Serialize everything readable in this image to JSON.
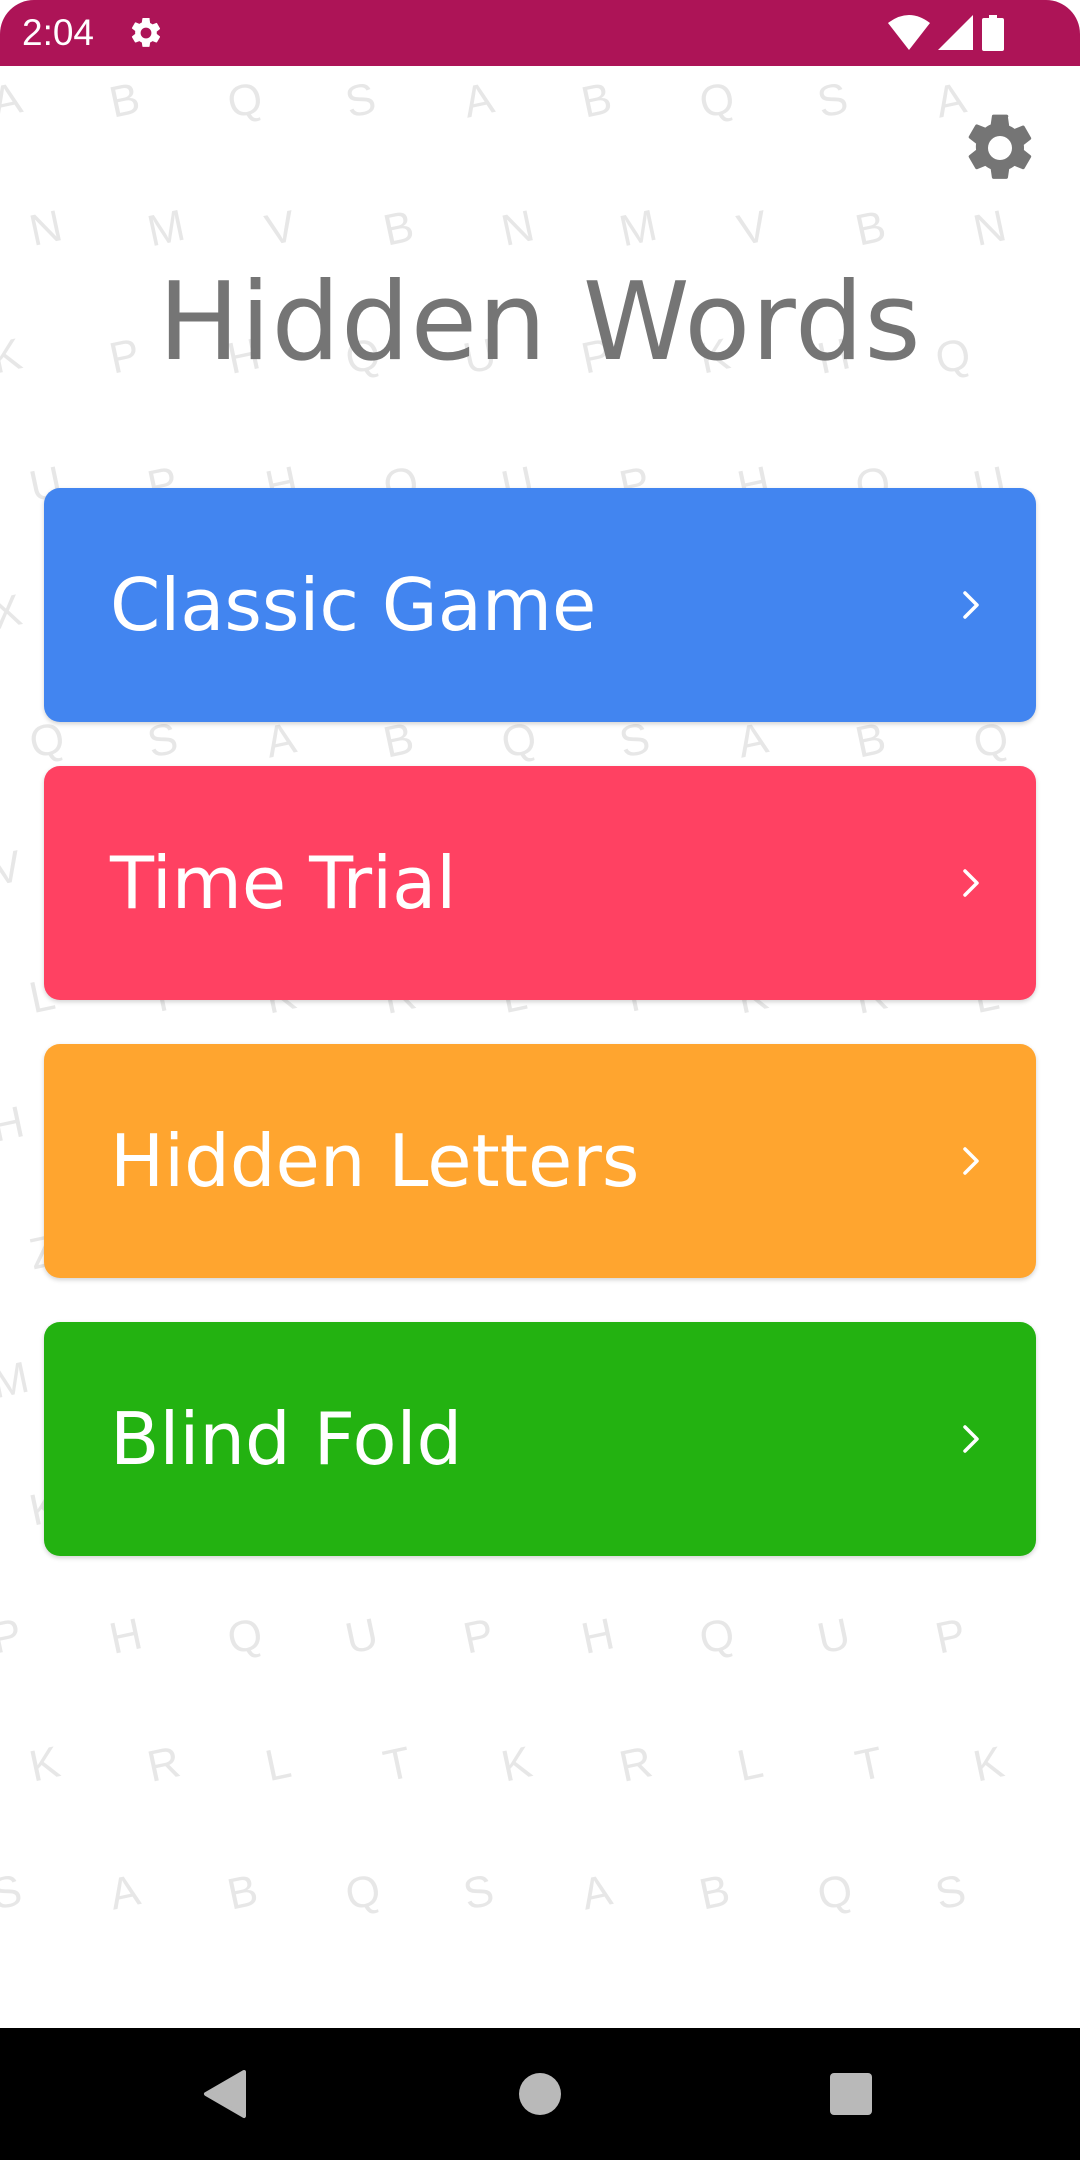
{
  "status_bar": {
    "time": "2:04",
    "background_color": "#AD1457",
    "icons": [
      "settings-gear-icon",
      "wifi-icon",
      "signal-icon",
      "battery-icon"
    ]
  },
  "background": {
    "letter_color": "#E7E7E7",
    "rows": [
      "A B Q S A B Q S A B",
      "N M V B N M V B N",
      "K P H Q U P K H Q U K",
      "U P H Q U P H Q U P",
      "X Z K P X Z K P X",
      "Q S A B Q S A B Q S",
      "V B N M V B N M V B",
      "L T K R L T K R L T",
      "H Q U P H Q U P H Q",
      "Z K P X Z K P X Z K",
      "M V B N M V B N M",
      "K P X Z K P X Z K",
      "P H Q U P H Q U P",
      "K R L T K R L T K",
      "S A B Q S A B Q S"
    ]
  },
  "header": {
    "settings_icon": "settings-gear-icon",
    "title": "Hidden Words"
  },
  "modes": [
    {
      "label": "Classic Game",
      "color": "#4285F0",
      "chevron": "chevron-right-icon"
    },
    {
      "label": "Time Trial",
      "color": "#FF4162",
      "chevron": "chevron-right-icon"
    },
    {
      "label": "Hidden Letters",
      "color": "#FFA52F",
      "chevron": "chevron-right-icon"
    },
    {
      "label": "Blind Fold",
      "color": "#23B211",
      "chevron": "chevron-right-icon"
    }
  ],
  "nav_bar": {
    "background_color": "#000000",
    "buttons": [
      "back-icon",
      "home-icon",
      "recents-icon"
    ]
  }
}
